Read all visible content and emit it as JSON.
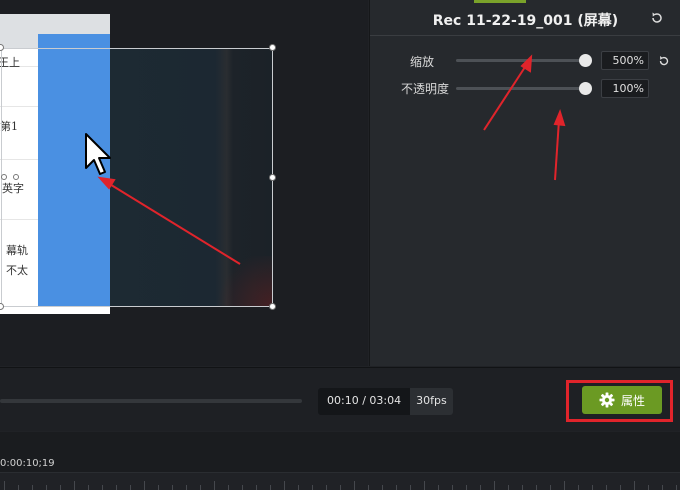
{
  "canvas": {
    "doc_texts": [
      "王上",
      "第1",
      "英字",
      "幕轨",
      "不太"
    ]
  },
  "properties": {
    "title": "Rec 11-22-19_001 (屏幕)",
    "scale": {
      "label": "缩放",
      "value_text": "500%",
      "level": 1.0
    },
    "opacity": {
      "label": "不透明度",
      "value_text": "100%",
      "level": 1.0
    }
  },
  "playback": {
    "time": "00:10 / 03:04",
    "fps": "30fps",
    "properties_button": "属性"
  },
  "timeline": {
    "playhead_time": "0:00:10;19"
  },
  "colors": {
    "accent_green": "#6b9a23",
    "highlight_red": "#e0242b",
    "clip_blue": "#4a90e2"
  },
  "icons": [
    "reset-icon",
    "gear-icon",
    "mouse-cursor-icon"
  ]
}
